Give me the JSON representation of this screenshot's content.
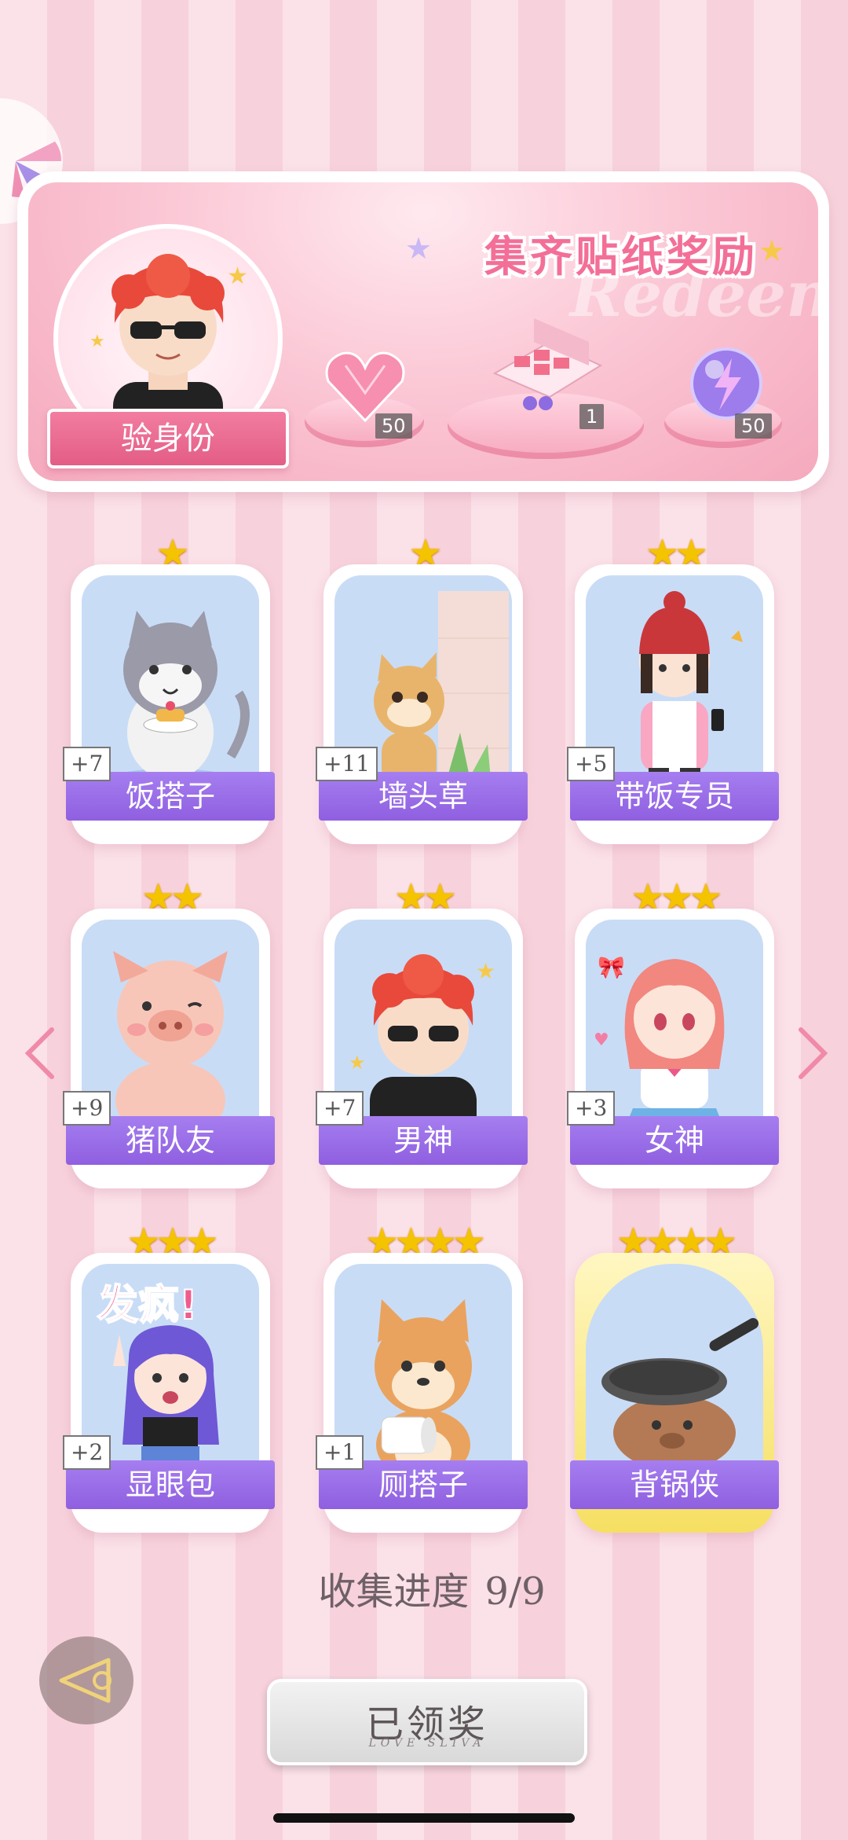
{
  "banner": {
    "title": "集齐贴纸奖励",
    "watermark": "Redeem",
    "verify_label": "验身份",
    "rewards": [
      {
        "name": "heart-gem",
        "qty": "50"
      },
      {
        "name": "gift-box",
        "qty": "1"
      },
      {
        "name": "lightning-orb",
        "qty": "50"
      }
    ]
  },
  "cards": [
    {
      "name": "饭搭子",
      "count": "+7",
      "stars": 1
    },
    {
      "name": "墙头草",
      "count": "+11",
      "stars": 1
    },
    {
      "name": "带饭专员",
      "count": "+5",
      "stars": 2
    },
    {
      "name": "猪队友",
      "count": "+9",
      "stars": 2
    },
    {
      "name": "男神",
      "count": "+7",
      "stars": 2
    },
    {
      "name": "女神",
      "count": "+3",
      "stars": 3
    },
    {
      "name": "显眼包",
      "count": "+2",
      "stars": 3,
      "art_text": "发疯!"
    },
    {
      "name": "厕搭子",
      "count": "+1",
      "stars": 4
    },
    {
      "name": "背锅侠",
      "count": "",
      "stars": 4
    }
  ],
  "progress": {
    "label": "收集进度",
    "value": "9/9"
  },
  "claimed_button": {
    "label": "已领奖",
    "sub": "LOVE SLIVA"
  },
  "colors": {
    "accent_pink": "#f36f98",
    "name_bar_purple": "#9a6ce6",
    "star_gold": "#f5c400"
  }
}
